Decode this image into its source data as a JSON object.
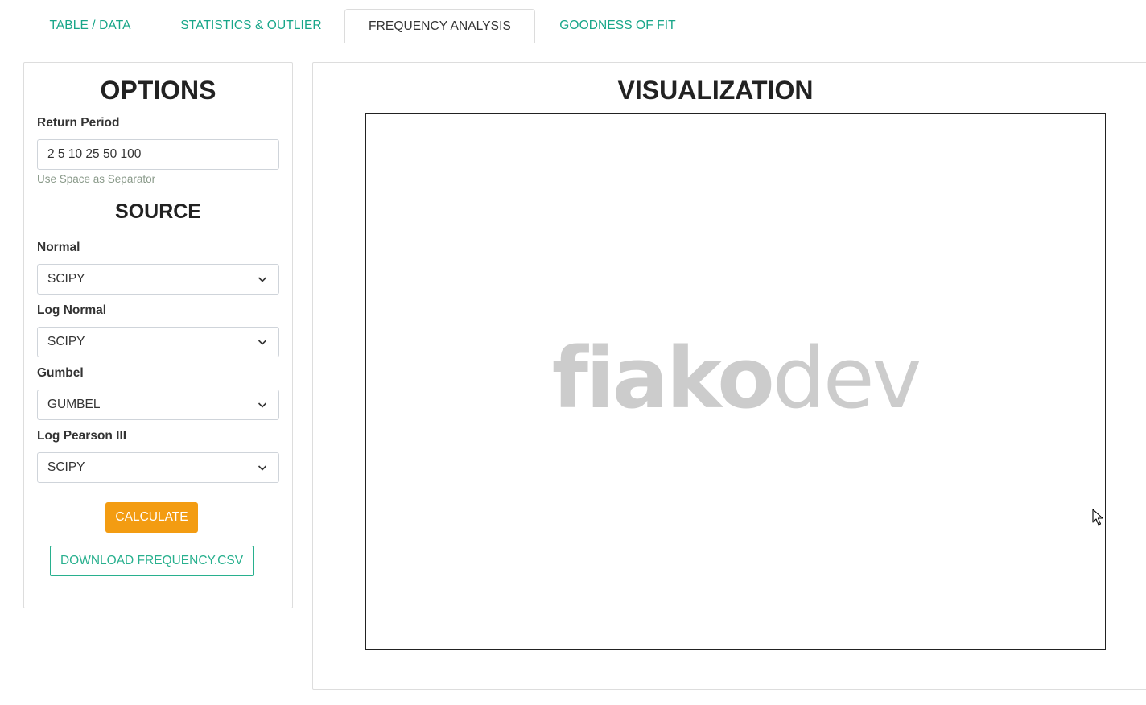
{
  "tabs": [
    {
      "label": "TABLE / DATA",
      "active": false
    },
    {
      "label": "STATISTICS & OUTLIER",
      "active": false
    },
    {
      "label": "FREQUENCY ANALYSIS",
      "active": true
    },
    {
      "label": "GOODNESS OF FIT",
      "active": false
    }
  ],
  "options": {
    "title": "OPTIONS",
    "return_period_label": "Return Period",
    "return_period_value": "2 5 10 25 50 100",
    "return_period_help": "Use Space as Separator",
    "source_title": "SOURCE",
    "sources": [
      {
        "label": "Normal",
        "value": "SCIPY"
      },
      {
        "label": "Log Normal",
        "value": "SCIPY"
      },
      {
        "label": "Gumbel",
        "value": "GUMBEL"
      },
      {
        "label": "Log Pearson III",
        "value": "SCIPY"
      }
    ],
    "calculate_label": "CALCULATE",
    "download_label": "DOWNLOAD FREQUENCY.CSV"
  },
  "visualization": {
    "title": "VISUALIZATION",
    "watermark_bold": "fiako",
    "watermark_light": "dev"
  },
  "colors": {
    "tab_link": "#18a689",
    "calculate_bg": "#f39c12",
    "download_outline": "#28b08e"
  }
}
